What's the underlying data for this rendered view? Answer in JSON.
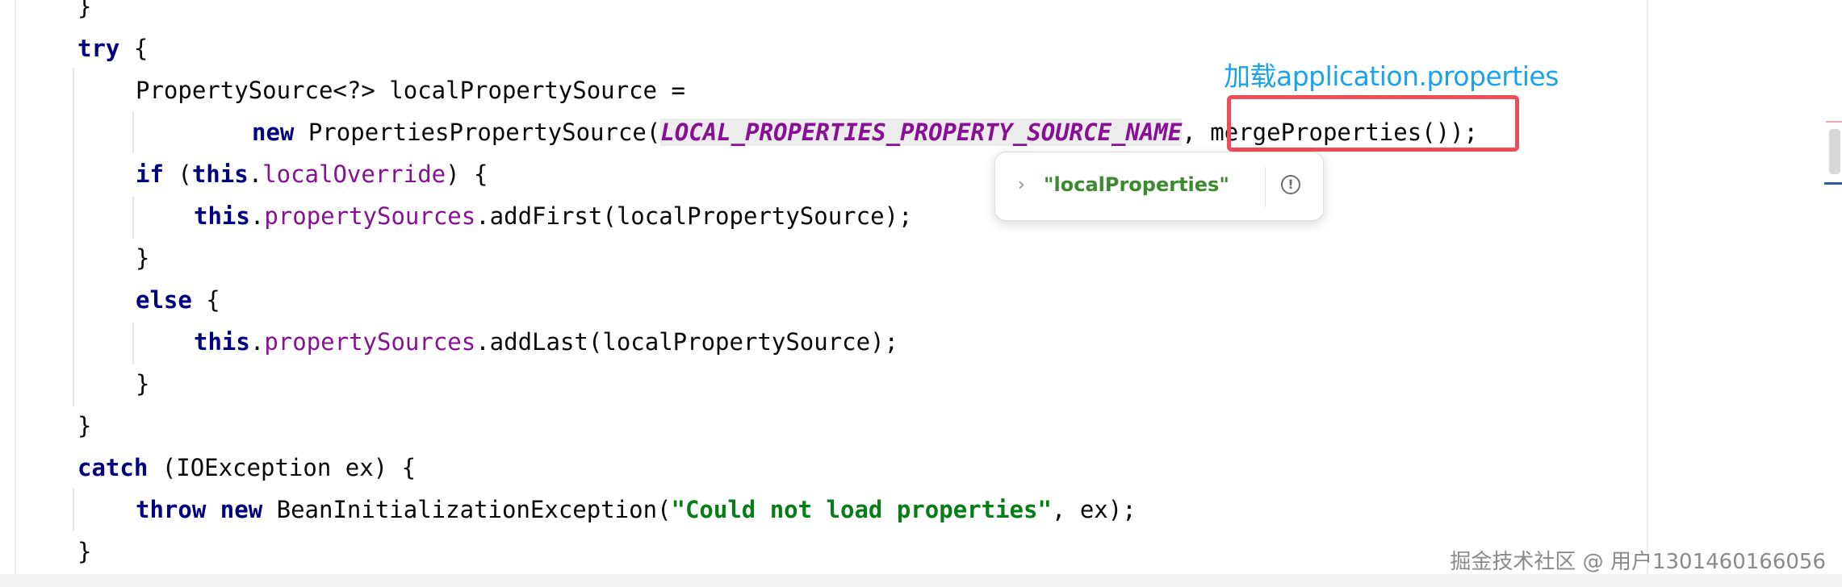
{
  "code": {
    "l0": "}",
    "l1_kw": "try",
    "l1_rest": " {",
    "l2": "PropertySource<?> localPropertySource =",
    "l3_kw": "new",
    "l3_a": " PropertiesPropertySource(",
    "l3_const": "LOCAL_PROPERTIES_PROPERTY_SOURCE_NAME",
    "l3_b": ", mergeProperties());",
    "l4_kw1": "if",
    "l4_a": " (",
    "l4_kw2": "this",
    "l4_b": ".",
    "l4_field": "localOverride",
    "l4_c": ") {",
    "l5_kw": "this",
    "l5_a": ".",
    "l5_field": "propertySources",
    "l5_b": ".addFirst(localPropertySource);",
    "l6": "}",
    "l7_kw": "else",
    "l7_rest": " {",
    "l8_kw": "this",
    "l8_a": ".",
    "l8_field": "propertySources",
    "l8_b": ".addLast(localPropertySource);",
    "l9": "}",
    "l10": "}",
    "l11_kw": "catch",
    "l11_rest": " (IOException ex) {",
    "l12_kw1": "throw",
    "l12_a": " ",
    "l12_kw2": "new",
    "l12_b": " BeanInitializationException(",
    "l12_str": "\"Could not load properties\"",
    "l12_c": ", ex);",
    "l13": "}"
  },
  "annotation": "加载application.properties",
  "tooltip": {
    "value": "\"localProperties\"",
    "chevron_icon": "chevron-right-icon",
    "info_icon": "info-icon",
    "info_glyph": "!"
  },
  "watermark": "掘金技术社区 @ 用户1301460166056",
  "colors": {
    "keyword": "#000080",
    "field": "#871094",
    "string": "#067d17",
    "highlight_box": "#ee4d55",
    "annotation": "#1aa2ec"
  }
}
